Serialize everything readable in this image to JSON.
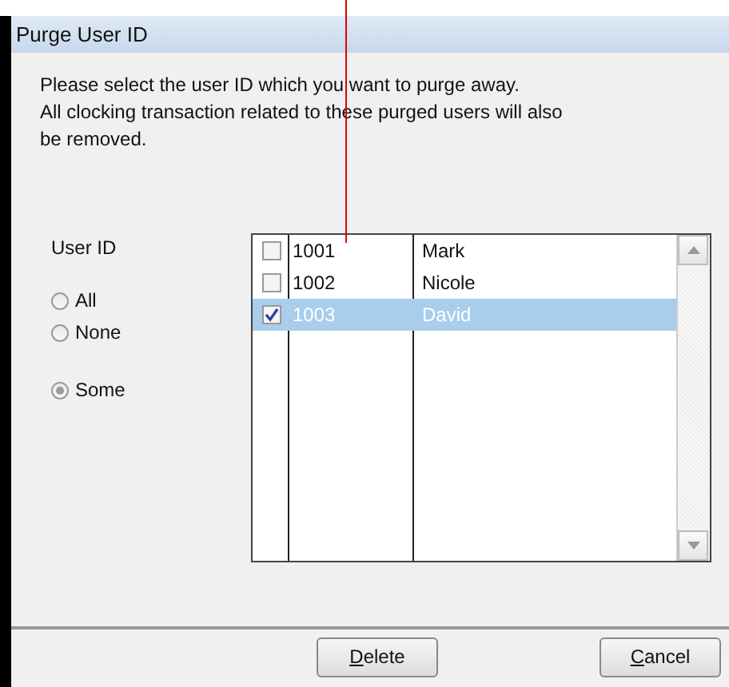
{
  "window": {
    "title": "Purge User ID"
  },
  "instructions": [
    "Please select the user ID which you want to purge away.",
    "All clocking transaction related to these purged users will also be removed."
  ],
  "user_id": {
    "label": "User ID",
    "options": [
      {
        "label": "All",
        "selected": false
      },
      {
        "label": "None",
        "selected": false
      },
      {
        "label": "Some",
        "selected": true
      }
    ]
  },
  "users": [
    {
      "id": "1001",
      "name": "Mark",
      "checked": false,
      "selected": false
    },
    {
      "id": "1002",
      "name": "Nicole",
      "checked": false,
      "selected": false
    },
    {
      "id": "1003",
      "name": "David",
      "checked": true,
      "selected": true
    }
  ],
  "buttons": [
    "Delete",
    "Cancel"
  ]
}
